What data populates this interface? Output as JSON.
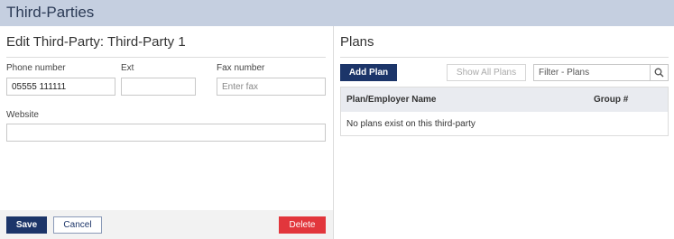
{
  "header": {
    "title": "Third-Parties"
  },
  "edit_panel": {
    "title": "Edit Third-Party: Third-Party 1",
    "phone": {
      "label": "Phone number",
      "value": "05555 111111"
    },
    "ext": {
      "label": "Ext",
      "value": ""
    },
    "fax": {
      "label": "Fax number",
      "value": "",
      "placeholder": "Enter fax"
    },
    "website": {
      "label": "Website",
      "value": ""
    },
    "save_label": "Save",
    "cancel_label": "Cancel",
    "delete_label": "Delete"
  },
  "plans_panel": {
    "title": "Plans",
    "add_plan_label": "Add Plan",
    "show_all_label": "Show All Plans",
    "filter_placeholder": "Filter - Plans",
    "columns": [
      "Plan/Employer Name",
      "Group #"
    ],
    "empty_message": "No plans exist on this third-party"
  },
  "colors": {
    "header_bg": "#c5cfe0",
    "primary": "#1c3569",
    "danger": "#e2363c"
  },
  "icons": {
    "search": "search-icon"
  }
}
